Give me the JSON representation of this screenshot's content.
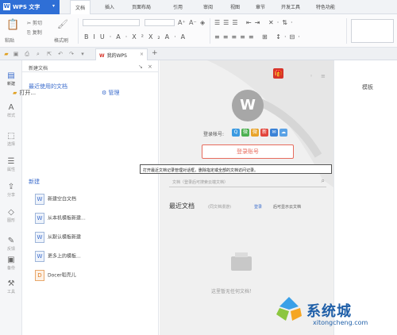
{
  "app": {
    "name": "WPS 文字",
    "logo": "W"
  },
  "menu": {
    "tabs": [
      {
        "label": "文档",
        "active": true
      },
      {
        "label": "插入"
      },
      {
        "label": "页面布局"
      },
      {
        "label": "引用"
      },
      {
        "label": "审阅"
      },
      {
        "label": "视图"
      },
      {
        "label": "章节"
      },
      {
        "label": "开发工具"
      },
      {
        "label": "特色功能"
      }
    ]
  },
  "ribbon": {
    "paste": "粘贴",
    "cut": "剪切",
    "copy": "复制",
    "format_painter": "格式刷"
  },
  "tabbar": {
    "doc_tab": "我的WPS",
    "add": "+"
  },
  "sidebar": {
    "items": [
      {
        "label": "新建",
        "icon": "new-doc-icon",
        "glyph": "▤",
        "active": true
      },
      {
        "label": "样式",
        "icon": "style-icon",
        "glyph": "A"
      },
      {
        "label": "选择",
        "icon": "select-icon",
        "glyph": "⬚"
      },
      {
        "label": "属性",
        "icon": "properties-icon",
        "glyph": "☰"
      },
      {
        "label": "分享",
        "icon": "share-icon",
        "glyph": "⇪"
      },
      {
        "label": "图形",
        "icon": "shape-icon",
        "glyph": "◇"
      },
      {
        "label": "反馈",
        "icon": "feedback-icon",
        "glyph": "✎"
      },
      {
        "label": "备份",
        "icon": "backup-icon",
        "glyph": "▣"
      },
      {
        "label": "工具",
        "icon": "tools-icon",
        "glyph": "⚒"
      }
    ]
  },
  "panel": {
    "title": "新建文档",
    "recent_title": "最近使用的文档",
    "open_label": "打开...",
    "manage_label": "管理",
    "new_title": "新建",
    "new_items": [
      {
        "label": "新建空白文档",
        "glyph": "W"
      },
      {
        "label": "从本机模板新建...",
        "glyph": "W"
      },
      {
        "label": "从默认模板新建",
        "glyph": "W"
      },
      {
        "label": "更多上的模板...",
        "glyph": "W"
      },
      {
        "label": "Docer稻壳儿",
        "glyph": "D"
      }
    ]
  },
  "tooltip": "打开最近文档记录管理对话框，删除指定或全部的文档访问记录。",
  "start": {
    "logo": "W",
    "login_label": "登录帐号:",
    "social": [
      {
        "name": "qq-icon",
        "color": "#3b9ae1",
        "glyph": "Q"
      },
      {
        "name": "wechat-icon",
        "color": "#4cb050",
        "glyph": "微"
      },
      {
        "name": "weibo-icon",
        "color": "#e8a32a",
        "glyph": "微"
      },
      {
        "name": "sina-icon",
        "color": "#e2453c",
        "glyph": "新"
      },
      {
        "name": "mail-icon",
        "color": "#3b82d6",
        "glyph": "✉"
      },
      {
        "name": "cloud-icon",
        "color": "#5aa2e6",
        "glyph": "☁"
      }
    ],
    "login_button": "登录账号",
    "search_placeholder": "文档（登录后可搜索云端文档）",
    "recent_docs": "最近文档",
    "recent_sub": "(同文档漫游)",
    "login_link": "登录",
    "cloud_link": "后可显示云文档",
    "empty": "这里暂无任何文档！"
  },
  "right": {
    "template": "模板"
  },
  "watermark": {
    "text": "系统城",
    "url": "xitongcheng.com"
  }
}
